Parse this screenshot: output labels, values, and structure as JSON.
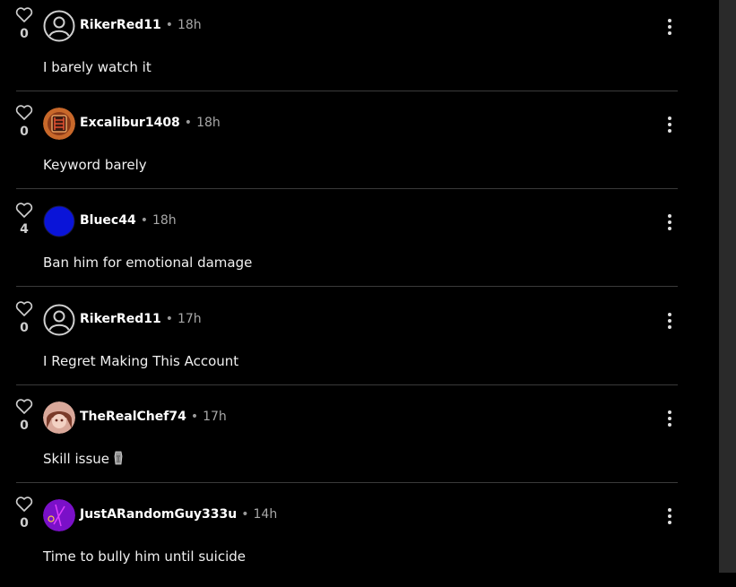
{
  "comments": [
    {
      "likes": "0",
      "user": "RikerRed11",
      "time": "18h",
      "text": "I barely watch it",
      "avatar": "default-avatar-icon"
    },
    {
      "likes": "0",
      "user": "Excalibur1408",
      "time": "18h",
      "text": "Keyword barely",
      "avatar": "custom-avatar"
    },
    {
      "likes": "4",
      "user": "Bluec44",
      "time": "18h",
      "text": "Ban him for emotional damage",
      "avatar": "blue-circle-avatar"
    },
    {
      "likes": "0",
      "user": "RikerRed11",
      "time": "17h",
      "text": "I Regret Making This Account",
      "avatar": "default-avatar-icon"
    },
    {
      "likes": "0",
      "user": "TheRealChef74",
      "time": "17h",
      "text": "Skill issue",
      "avatar": "anime-avatar",
      "emoji": "moai-emoji"
    },
    {
      "likes": "0",
      "user": "JustARandomGuy333u",
      "time": "14h",
      "text": "Time to bully him until suicide",
      "avatar": "purple-avatar"
    }
  ],
  "separator": "•",
  "colors": {
    "background": "#000000",
    "divider": "#3a3a3a",
    "scrollbar": "#2a2a2a",
    "text": "#f0f0f0",
    "muted": "#a8a8a8"
  }
}
